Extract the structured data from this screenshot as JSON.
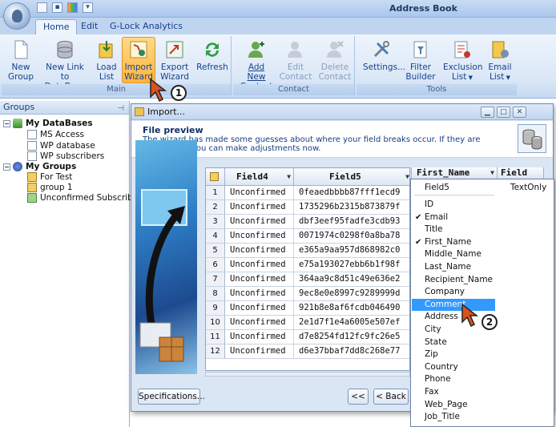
{
  "window": {
    "title": "Address Book"
  },
  "tabs": [
    {
      "label": "Home"
    },
    {
      "label": "Edit"
    },
    {
      "label": "G-Lock Analytics"
    }
  ],
  "ribbon": {
    "groups": {
      "main": "Main",
      "contact": "Contact",
      "tools": "Tools"
    },
    "buttons": {
      "new_group": [
        "New",
        "Group"
      ],
      "new_link": [
        "New Link",
        "to DataBase"
      ],
      "load_list": [
        "Load",
        "List"
      ],
      "import_wizard": [
        "Import",
        "Wizard"
      ],
      "export_wizard": [
        "Export",
        "Wizard"
      ],
      "refresh": [
        "Refresh"
      ],
      "add_contact": [
        "Add New",
        "Contact"
      ],
      "edit_contact": [
        "Edit",
        "Contact"
      ],
      "delete_contact": [
        "Delete",
        "Contact"
      ],
      "settings": [
        "Settings..."
      ],
      "filter_builder": [
        "Filter",
        "Builder"
      ],
      "exclusion_list": [
        "Exclusion",
        "List"
      ],
      "email_list": [
        "Email",
        "List"
      ]
    }
  },
  "left_pane": {
    "title": "Groups",
    "databases_label": "My DataBases",
    "databases": [
      "MS Access",
      "WP database",
      "WP subscribers"
    ],
    "groups_label": "My Groups",
    "groups": [
      "For Test",
      "group 1",
      "Unconfirmed Subscribers"
    ]
  },
  "dialog": {
    "title": "Import...",
    "header_title": "File preview",
    "header_text": "The wizard has made some guesses about where your field breaks occur. If they are not correct, you can make adjustments now.",
    "columns": [
      "Field4",
      "Field5",
      "First_Name",
      "Field"
    ],
    "rows": [
      {
        "n": "1",
        "f4": "Unconfirmed",
        "f5": "0feaedbbbb87fff1ecd9"
      },
      {
        "n": "2",
        "f4": "Unconfirmed",
        "f5": "1735296b2315b873879f"
      },
      {
        "n": "3",
        "f4": "Unconfirmed",
        "f5": "dbf3eef95fadfe3cdb93"
      },
      {
        "n": "4",
        "f4": "Unconfirmed",
        "f5": "0071974c0298f0a8ba78"
      },
      {
        "n": "5",
        "f4": "Unconfirmed",
        "f5": "e365a9aa957d868982c0"
      },
      {
        "n": "6",
        "f4": "Unconfirmed",
        "f5": "e75a193027ebb6b1f98f"
      },
      {
        "n": "7",
        "f4": "Unconfirmed",
        "f5": "364aa9c8d51c49e636e2"
      },
      {
        "n": "8",
        "f4": "Unconfirmed",
        "f5": "9ec8e0e8997c9289999d"
      },
      {
        "n": "9",
        "f4": "Unconfirmed",
        "f5": "921b8e8af6fcdb046490"
      },
      {
        "n": "10",
        "f4": "Unconfirmed",
        "f5": "2e1d7f1e4a6005e507ef"
      },
      {
        "n": "11",
        "f4": "Unconfirmed",
        "f5": "d7e8254fd12fc9fc26e5"
      },
      {
        "n": "12",
        "f4": "Unconfirmed",
        "f5": "d6e37bbaf7dd8c268e77"
      }
    ],
    "buttons": {
      "specifications": "Specifications...",
      "first": "<<",
      "back": "< Back"
    }
  },
  "dropdown": {
    "items": [
      "Field5",
      "ID",
      "Email",
      "Title",
      "First_Name",
      "Middle_Name",
      "Last_Name",
      "Recipient_Name",
      "Company",
      "Comment",
      "Address",
      "City",
      "State",
      "Zip",
      "Country",
      "Phone",
      "Fax",
      "Web_Page",
      "Job_Title"
    ],
    "checked": [
      "Email",
      "First_Name"
    ],
    "selected": "Comment",
    "side_label": "TextOnly"
  },
  "callouts": {
    "one": "1",
    "two": "2"
  },
  "colors": {
    "selection": "#3399ff",
    "ribbon_text": "#15428b",
    "active_button": "#ffb53f"
  }
}
